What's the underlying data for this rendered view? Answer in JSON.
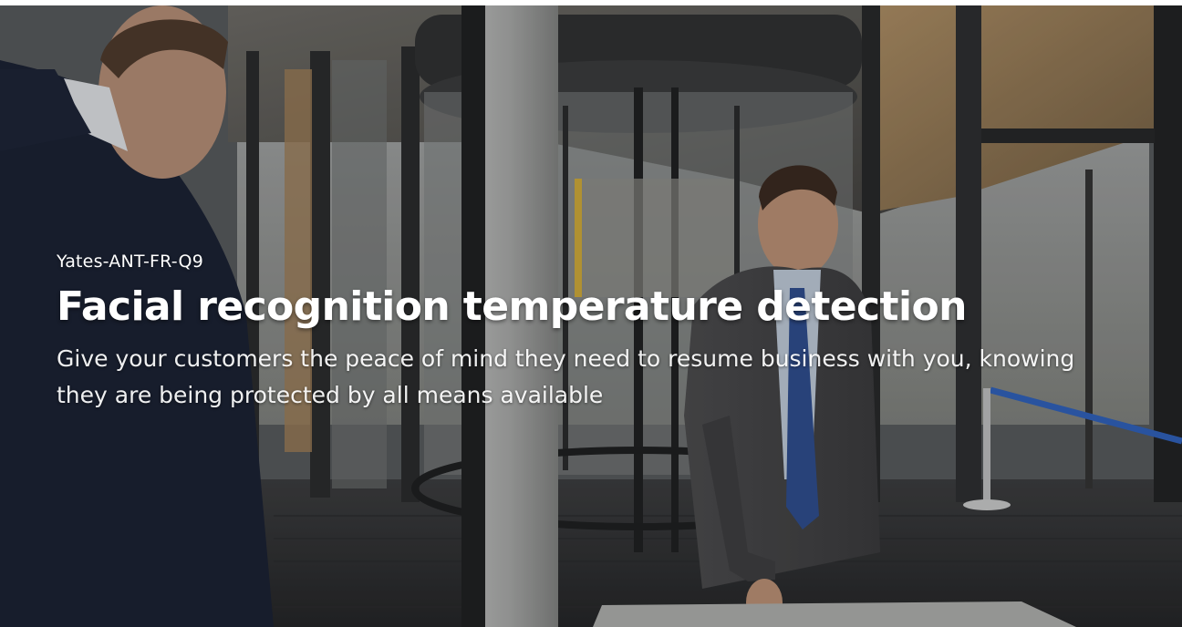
{
  "banner": {
    "product_code": "Yates-ANT-FR-Q9",
    "title": "Facial recognition temperature detection",
    "description": "Give your customers the peace of mind they need to resume business with you, knowing they are being protected by all means available",
    "background_image": "photo-two-businessmen-revolving-door-lobby"
  }
}
